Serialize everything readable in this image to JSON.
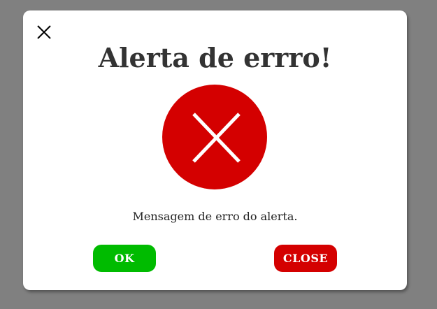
{
  "dialog": {
    "title": "Alerta de errro!",
    "message": "Mensagem de erro do alerta.",
    "ok_label": "OK",
    "close_label": "CLOSE",
    "close_icon": "close-icon",
    "status_icon": "error-x-icon"
  },
  "colors": {
    "backdrop": "#808080",
    "dialog_bg": "#ffffff",
    "title_text": "#333333",
    "error_red": "#d40000",
    "ok_green": "#00bb00",
    "close_red": "#d40000",
    "button_text": "#ffffff"
  }
}
